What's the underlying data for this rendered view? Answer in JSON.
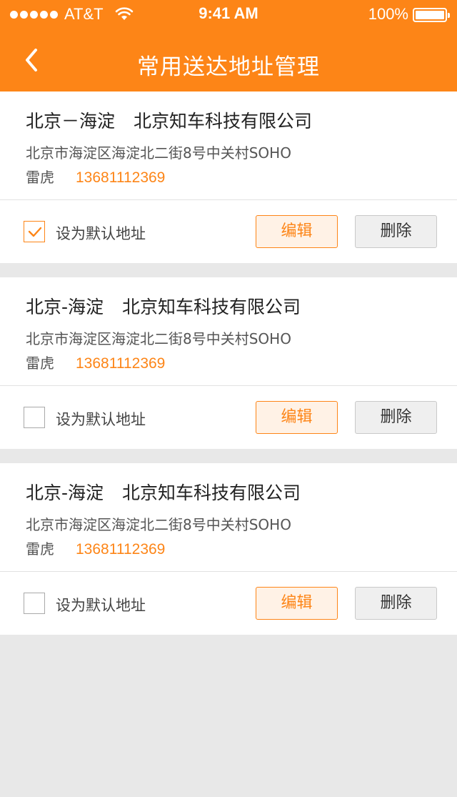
{
  "status_bar": {
    "carrier": "AT&T",
    "time": "9:41 AM",
    "battery": "100%"
  },
  "nav": {
    "title": "常用送达地址管理"
  },
  "colors": {
    "accent": "#fd8517",
    "background": "#e8e8e8"
  },
  "actions": {
    "default_label": "设为默认地址",
    "edit_label": "编辑",
    "delete_label": "删除"
  },
  "addresses": [
    {
      "region": "北京－海淀",
      "company": "北京知车科技有限公司",
      "detail": "北京市海淀区海淀北二街8号中关村SOHO",
      "contact": "雷虎",
      "phone": "13681112369",
      "is_default": true
    },
    {
      "region": "北京-海淀",
      "company": "北京知车科技有限公司",
      "detail": "北京市海淀区海淀北二街8号中关村SOHO",
      "contact": "雷虎",
      "phone": "13681112369",
      "is_default": false
    },
    {
      "region": "北京-海淀",
      "company": "北京知车科技有限公司",
      "detail": "北京市海淀区海淀北二街8号中关村SOHO",
      "contact": "雷虎",
      "phone": "13681112369",
      "is_default": false
    }
  ]
}
